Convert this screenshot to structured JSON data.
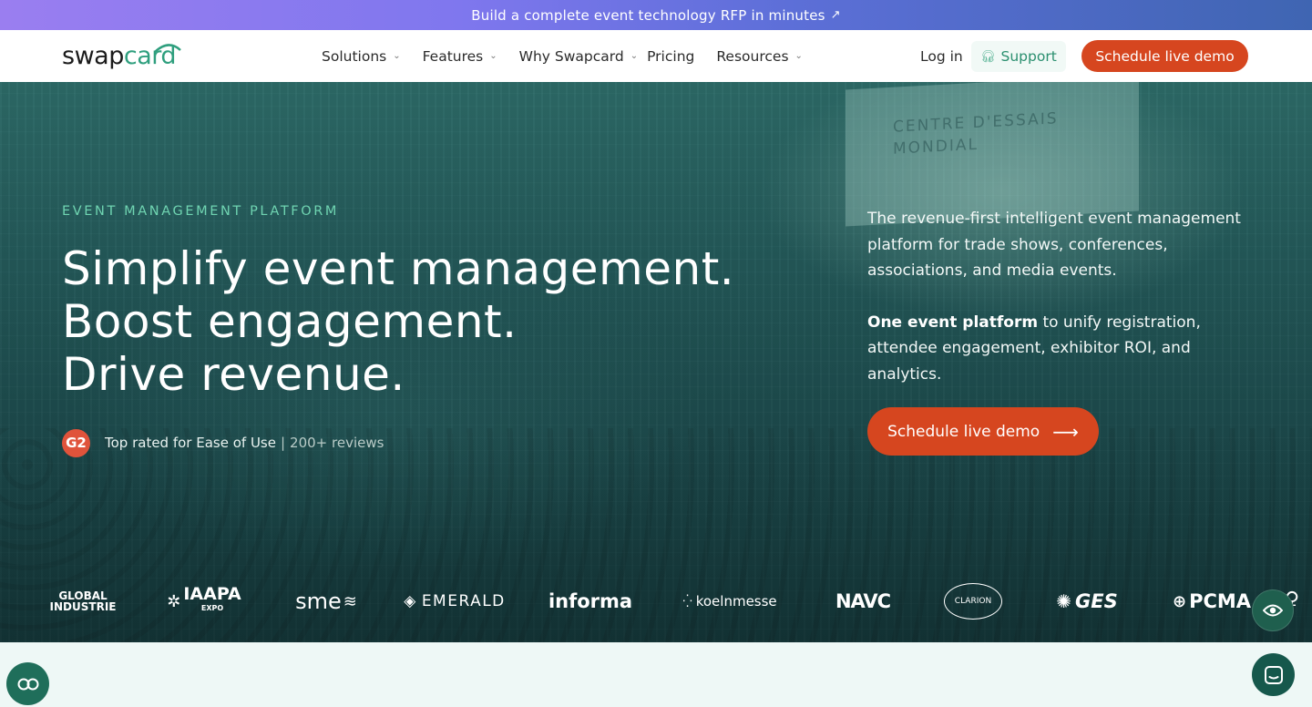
{
  "announcement": {
    "text": "Build a complete event technology RFP in minutes",
    "arrow": "↗"
  },
  "header": {
    "logo": {
      "part1": "swap",
      "part2": "card"
    },
    "nav": [
      {
        "label": "Solutions",
        "has_dropdown": true
      },
      {
        "label": "Features",
        "has_dropdown": true
      },
      {
        "label": "Why Swapcard",
        "has_dropdown": true
      },
      {
        "label": "Pricing",
        "has_dropdown": false
      },
      {
        "label": "Resources",
        "has_dropdown": true
      }
    ],
    "login": "Log in",
    "support": "Support",
    "cta": "Schedule live demo"
  },
  "hero": {
    "background_sign": "CENTRE D'ESSAIS MONDIAL",
    "eyebrow": "EVENT MANAGEMENT PLATFORM",
    "headline": [
      "Simplify event management.",
      "Boost engagement.",
      "Drive revenue."
    ],
    "rating": {
      "badge": "G2",
      "text": "Top rated for Ease of Use",
      "separator": "|",
      "reviews": "200+ reviews"
    },
    "description": "The revenue-first intelligent event management platform for trade shows, conferences, associations, and media events.",
    "description2_bold": "One event platform",
    "description2_rest": " to unify registration, attendee engagement, exhibitor ROI, and analytics.",
    "cta": "Schedule live demo",
    "cta_arrow": "⟶"
  },
  "logos": [
    {
      "line1": "GLOBAL",
      "line2": "INDUSTRIE"
    },
    {
      "name": "IAAPA",
      "sub": "EXPO"
    },
    {
      "name": "sme"
    },
    {
      "name": "EMERALD"
    },
    {
      "name": "informa"
    },
    {
      "name": "koelnmesse"
    },
    {
      "name": "NAVC"
    },
    {
      "name": "CLARION"
    },
    {
      "name": "GES"
    },
    {
      "name": "PCMA"
    }
  ],
  "colors": {
    "brand_accent": "#d6461f",
    "brand_green": "#2f9f7e",
    "eyebrow": "#6fd4b1",
    "hero_bg": "#245a5a",
    "announce_start": "#9a7ef0",
    "announce_end": "#3f65b2"
  },
  "icons": {
    "support": "headset-icon",
    "eye": "eye-icon",
    "cookie": "cookie-settings-icon",
    "chat": "chat-icon"
  }
}
